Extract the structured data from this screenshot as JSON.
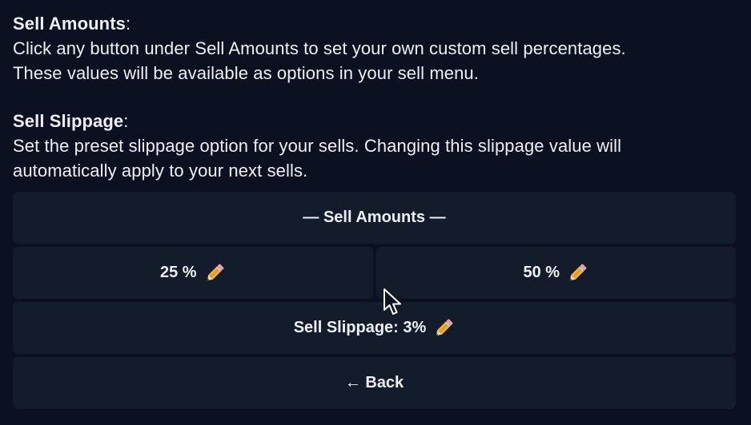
{
  "message": {
    "sell_amounts_title": "Sell Amounts",
    "sell_amounts_colon": ":",
    "sell_amounts_line1": "Click any button under Sell Amounts to set your own custom sell percentages.",
    "sell_amounts_line2": "These values will be available as options in your sell menu.",
    "sell_slippage_title": "Sell Slippage",
    "sell_slippage_colon": ":",
    "sell_slippage_line1": "Set the preset slippage option for your sells. Changing this slippage value will",
    "sell_slippage_line2": "automatically apply to your next sells."
  },
  "keyboard": {
    "header_label": "— Sell Amounts —",
    "amount_25_label": "25 %",
    "amount_50_label": "50 %",
    "slippage_label": "Sell Slippage: 3%",
    "back_label": "← Back"
  },
  "icons": {
    "edit": "pencil-icon",
    "pointer": "mouse-pointer"
  },
  "colors": {
    "background": "#0b1120",
    "button": "#131c2b",
    "text": "#eef0f3"
  }
}
